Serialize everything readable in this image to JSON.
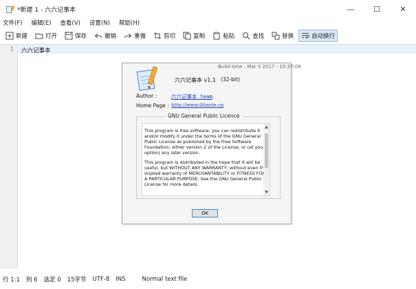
{
  "window": {
    "title": "*新建 1 - 六六记事本",
    "controls": {
      "minimize": "—",
      "maximize": "☐",
      "close": "✕"
    }
  },
  "menu": {
    "items": [
      "文件(F)",
      "编辑(E)",
      "查看(V)",
      "设置(N)",
      "帮助(H)"
    ]
  },
  "toolbar": {
    "new": "新建",
    "open": "打开",
    "save": "保存",
    "undo": "撤销",
    "redo": "重做",
    "cut": "剪切",
    "copy": "复制",
    "paste": "粘贴",
    "find": "查找",
    "replace": "替换",
    "wrap": "自动换行"
  },
  "editor": {
    "line_number": "1",
    "line_text": "六六记事本"
  },
  "about": {
    "build_time": "Build time : Mar  3 2017 - 15:37:08",
    "app_name": "六六记事本 v1.1",
    "bits": "(32-bit)",
    "author_label": "Author :",
    "author_value": "六六记事本 team",
    "home_label": "Home Page :",
    "home_value": "http://www.66note.cn",
    "licence_title": "GNU General Public Licence",
    "licence_p1": "This program is free software; you can redistribute it and/or modify it under the terms of the GNU General Public License as published by the Free Software Foundation; either version 2 of the License, or (at your option) any later version.",
    "licence_p2": "This program is distributed in the hope that it will be useful, but WITHOUT ANY WARRANTY; without even the implied warranty of MERCHANTABILITY or FITNESS FOR A PARTICULAR PURPOSE.  See the GNU General Public License for more details.",
    "ok": "OK"
  },
  "status": {
    "position": "行 1:1",
    "column": "列 6",
    "selection": "选定 0",
    "bytes": "15字节",
    "encoding": "UTF-8",
    "mode": "INS",
    "file_type": "Normal text file"
  },
  "colors": {
    "accent": "#3c7fd1",
    "link": "#1a3fb0",
    "line_highlight": "#e8f2fe"
  }
}
